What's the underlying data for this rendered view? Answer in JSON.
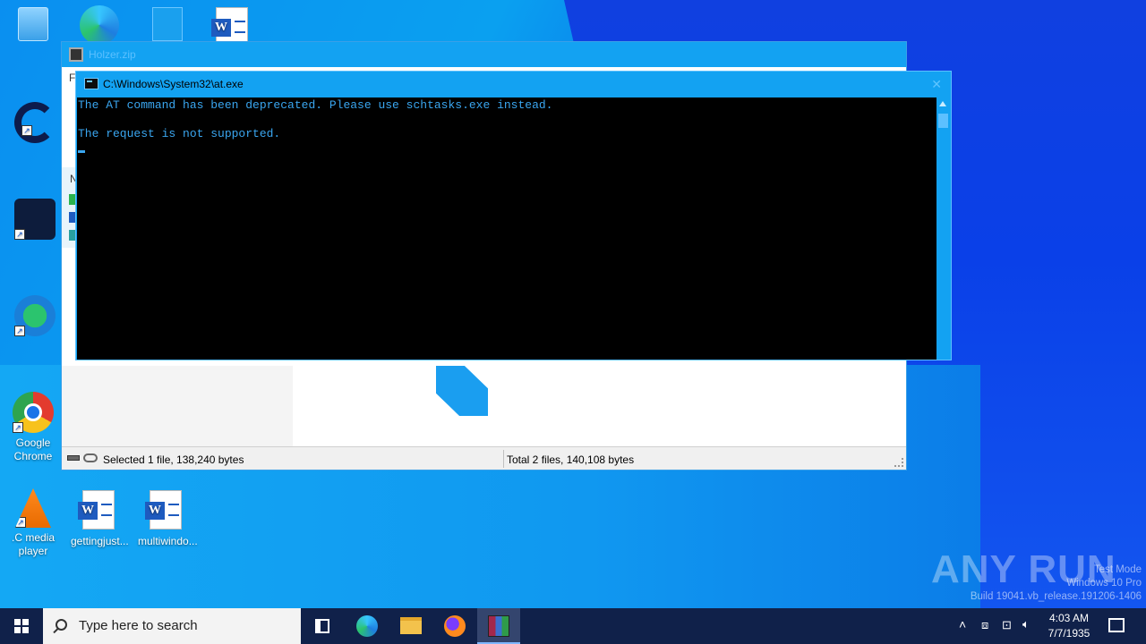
{
  "desktop": {
    "icons": [
      {
        "name": "recycle-bin",
        "label": ""
      },
      {
        "name": "edge",
        "label": ""
      },
      {
        "name": "file",
        "label": ""
      },
      {
        "name": "word-doc-top",
        "label": ""
      },
      {
        "name": "ccleaner",
        "label": ""
      },
      {
        "name": "acrobat",
        "label": ""
      },
      {
        "name": "network-app",
        "label": ""
      },
      {
        "name": "chrome",
        "label": "Google Chrome"
      },
      {
        "name": "vlc",
        "label": ".C media player"
      },
      {
        "name": "word-doc-1",
        "label": "gettingjust..."
      },
      {
        "name": "word-doc-2",
        "label": "multiwindo..."
      }
    ]
  },
  "zip_window": {
    "title": "Holzer.zip",
    "menu_first_letter": "Fi",
    "side_label": "N",
    "status_left": "Selected 1 file, 138,240 bytes",
    "status_right": "Total 2 files, 140,108 bytes"
  },
  "console_window": {
    "title": "C:\\Windows\\System32\\at.exe",
    "lines": [
      "The AT command has been deprecated. Please use schtasks.exe instead.",
      "",
      "The request is not supported."
    ]
  },
  "watermark": {
    "brand": "ANY RUN",
    "line1": "Test Mode",
    "line2": "Windows 10 Pro",
    "line3": "Build 19041.vb_release.191206-1406"
  },
  "taskbar": {
    "search_placeholder": "Type here to search",
    "time": "4:03 AM",
    "date": "7/7/1935",
    "pinned": [
      "task-view",
      "edge",
      "file-explorer",
      "firefox",
      "winrar"
    ]
  }
}
